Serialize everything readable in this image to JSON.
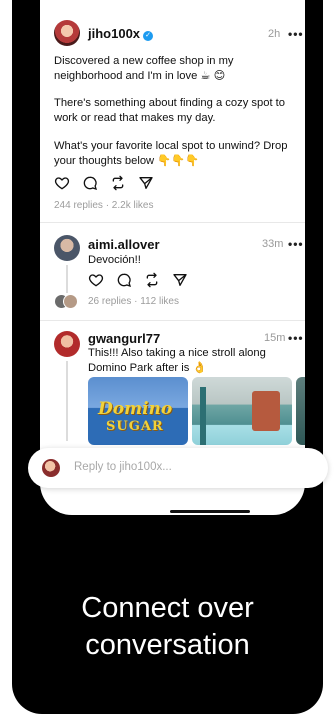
{
  "post": {
    "username": "jiho100x",
    "time": "2h",
    "more": "•••",
    "paragraphs": [
      "Discovered a new coffee shop in my neighborhood and I'm in love ☕ 😊",
      "There's something about finding a cozy spot to work or read that makes my day.",
      "What's your favorite local spot to unwind? Drop your thoughts below 👇👇👇"
    ],
    "stats": "244 replies · 2.2k likes"
  },
  "reply1": {
    "username": "aimi.allover",
    "time": "33m",
    "more": "•••",
    "text": "Devoción!!",
    "stats": "26 replies · 112 likes"
  },
  "reply2": {
    "username": "gwangurl77",
    "time": "15m",
    "more": "•••",
    "text": "This!!! Also taking a nice stroll along Domino Park after is 👌",
    "sign_line1": "Domino",
    "sign_line2": "SUGAR"
  },
  "reply_bar": {
    "placeholder": "Reply to jiho100x..."
  },
  "tagline": {
    "line1": "Connect over",
    "line2": "conversation"
  }
}
